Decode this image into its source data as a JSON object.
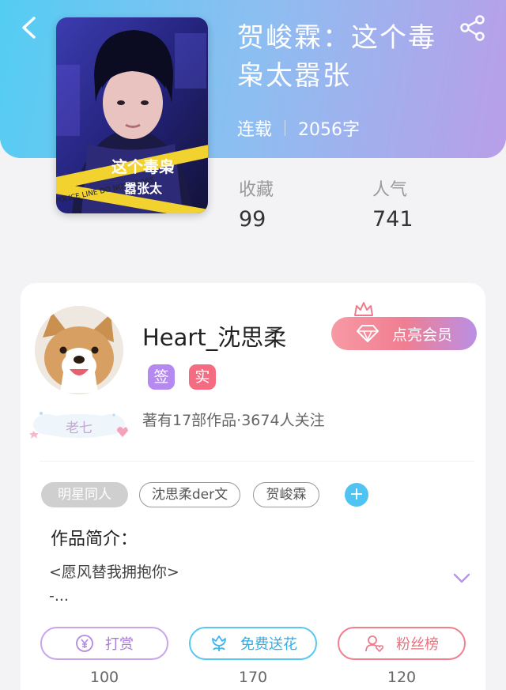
{
  "book": {
    "title": "贺峻霖：这个毒枭太嚣张",
    "status": "连载",
    "word_count": "2056字",
    "cover_text_line1": "这个毒枭",
    "cover_text_line2": "嚣张太",
    "cover_tape_text": "POLICE LINE DO NOT CROSS"
  },
  "stats": {
    "favorites_label": "收藏",
    "favorites_value": "99",
    "popularity_label": "人气",
    "popularity_value": "741"
  },
  "author": {
    "name": "Heart_沈思柔",
    "badge_sign": "签",
    "badge_real": "实",
    "meta": "著有17部作品·3674人关注",
    "level": "老七",
    "vip_label": "点亮会员"
  },
  "tags": [
    "明星同人",
    "沈思柔der文",
    "贺峻霖"
  ],
  "add_tag_symbol": "+",
  "intro": {
    "label": "作品简介：",
    "line1": "<愿风替我拥抱你>",
    "line2": "-..."
  },
  "actions": [
    {
      "label": "打赏",
      "count": "100"
    },
    {
      "label": "免费送花",
      "count": "170"
    },
    {
      "label": "粉丝榜",
      "count": "120"
    }
  ],
  "colors": {
    "header_start": "#53cdf2",
    "header_end": "#b99ee9",
    "vip_start": "#f79aa4",
    "vip_end": "#ba8fe5",
    "accent_blue": "#4fc3f1",
    "accent_pink": "#f46c81",
    "accent_purple": "#b58af0"
  }
}
